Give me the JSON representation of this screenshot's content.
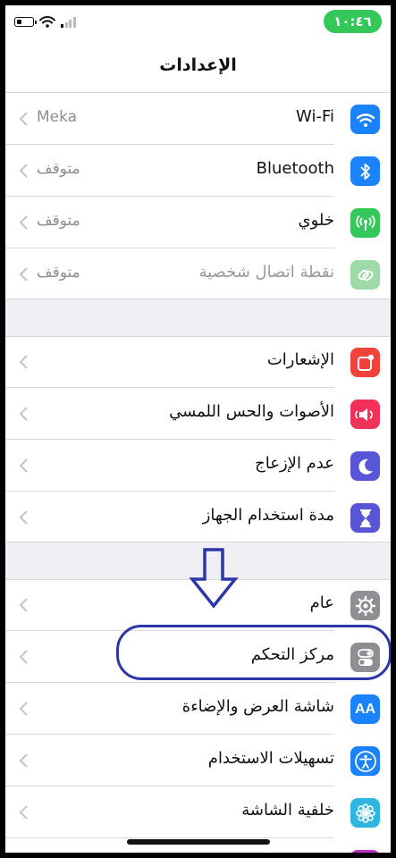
{
  "status": {
    "time": "١٠:٤٦"
  },
  "nav": {
    "title": "الإعدادات"
  },
  "group1": [
    {
      "key": "wifi",
      "label": "Wi-Fi",
      "value": "Meka",
      "icon": "wifi-icon",
      "color": "#1a82fb"
    },
    {
      "key": "bluetooth",
      "label": "Bluetooth",
      "value": "متوقف",
      "icon": "bluetooth-icon",
      "color": "#1a82fb"
    },
    {
      "key": "cellular",
      "label": "خلوي",
      "value": "متوقف",
      "icon": "cellular-icon",
      "color": "#34c759"
    },
    {
      "key": "hotspot",
      "label": "نقطة اتصال شخصية",
      "value": "متوقف",
      "icon": "hotspot-icon",
      "color": "#9ed9a8"
    }
  ],
  "group2": [
    {
      "key": "notifications",
      "label": "الإشعارات",
      "icon": "notifications-icon",
      "color": "#f0423a"
    },
    {
      "key": "sounds",
      "label": "الأصوات والحس اللمسي",
      "icon": "sounds-icon",
      "color": "#f0315a"
    },
    {
      "key": "dnd",
      "label": "عدم الإزعاج",
      "icon": "moon-icon",
      "color": "#5856d6"
    },
    {
      "key": "screentime",
      "label": "مدة استخدام الجهاز",
      "icon": "hourglass-icon",
      "color": "#5856d6"
    }
  ],
  "group3": [
    {
      "key": "general",
      "label": "عام",
      "icon": "gear-icon",
      "color": "#8e8e93"
    },
    {
      "key": "control_center",
      "label": "مركز التحكم",
      "icon": "toggles-icon",
      "color": "#8e8e93"
    },
    {
      "key": "display",
      "label": "شاشة العرض والإضاءة",
      "icon": "text-size-icon",
      "color": "#1a82fb",
      "glyph": "AA"
    },
    {
      "key": "accessibility",
      "label": "تسهيلات الاستخدام",
      "icon": "accessibility-icon",
      "color": "#1a82fb"
    },
    {
      "key": "wallpaper",
      "label": "خلفية الشاشة",
      "icon": "flower-icon",
      "color": "#2fb6e0"
    }
  ]
}
